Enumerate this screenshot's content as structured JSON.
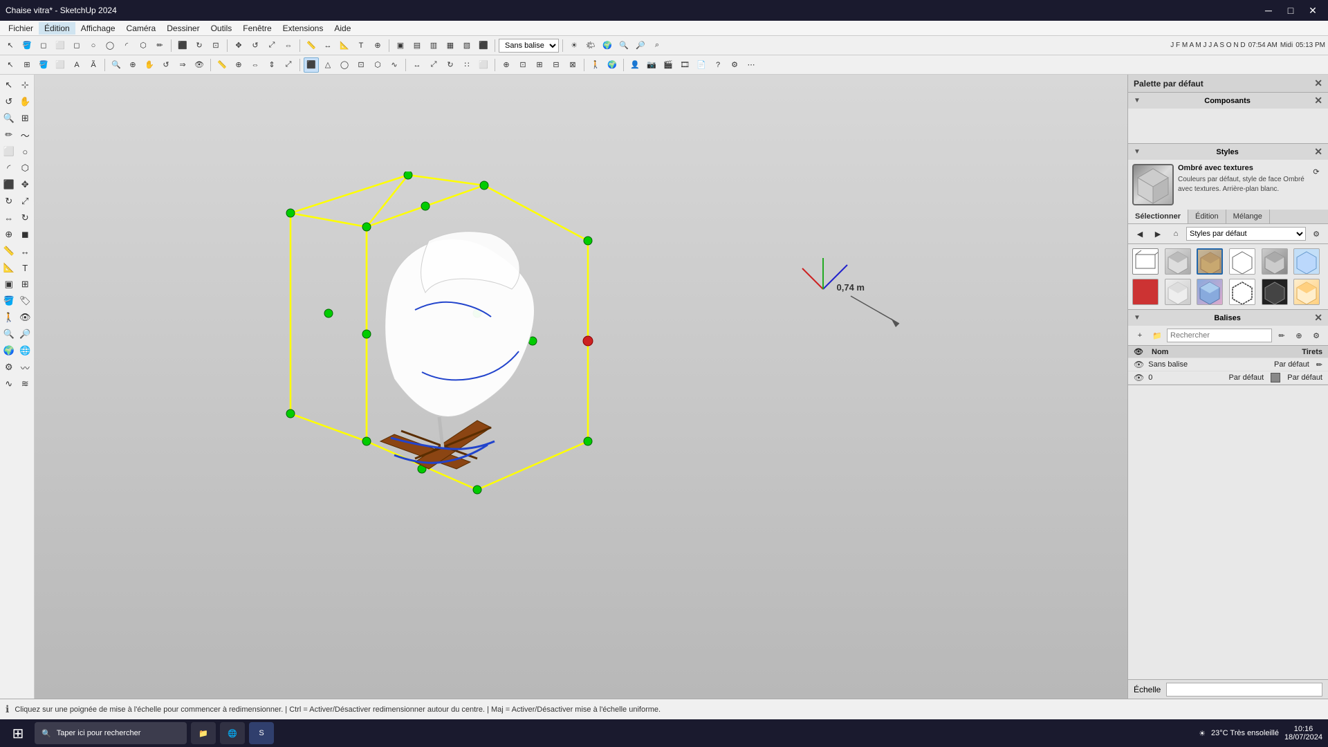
{
  "titlebar": {
    "title": "Chaise vitra* - SketchUp 2024",
    "controls": [
      "—",
      "□",
      "✕"
    ]
  },
  "menubar": {
    "items": [
      "Fichier",
      "Édition",
      "Affichage",
      "Caméra",
      "Dessiner",
      "Outils",
      "Fenêtre",
      "Extensions",
      "Aide"
    ],
    "active": "Édition"
  },
  "toolbar1": {
    "style_label": "Sans balise",
    "time_display": "07:54 AM",
    "period": "Midi",
    "end_time": "05:13 PM"
  },
  "right_panel": {
    "title": "Palette par défaut",
    "sections": {
      "composants": {
        "label": "Composants"
      },
      "styles": {
        "label": "Styles",
        "style_name": "Ombré avec textures",
        "style_desc": "Couleurs par défaut, style de face Ombré avec textures. Arrière-plan blanc.",
        "tabs": [
          "Sélectionner",
          "Édition",
          "Mélange"
        ],
        "active_tab": "Sélectionner",
        "dropdown": "Styles par défaut"
      },
      "balises": {
        "label": "Balises",
        "search_placeholder": "Rechercher",
        "columns": {
          "nom": "Nom",
          "tirets": "Tirets"
        },
        "rows": [
          {
            "visible": true,
            "name": "Sans balise",
            "tirets": "Par défaut",
            "color": "#888888",
            "color2": "Par défaut"
          },
          {
            "visible": true,
            "name": "0",
            "tirets": "Par défaut",
            "color": "#888888",
            "color2": "Par défaut"
          }
        ]
      }
    }
  },
  "bottom": {
    "echelle_label": "Échelle",
    "status_text": "Cliquez sur une poignée de mise à l'échelle pour commencer à redimensionner.  |  Ctrl = Activer/Désactiver redimensionner autour du centre.  |  Maj = Activer/Désactiver mise à l'échelle uniforme."
  },
  "scale_indicator": "0,74 m",
  "taskbar": {
    "search_placeholder": "Taper ici pour rechercher",
    "weather": "23°C  Très ensoleillé",
    "time": "10:16",
    "date": "18/07/2024"
  }
}
